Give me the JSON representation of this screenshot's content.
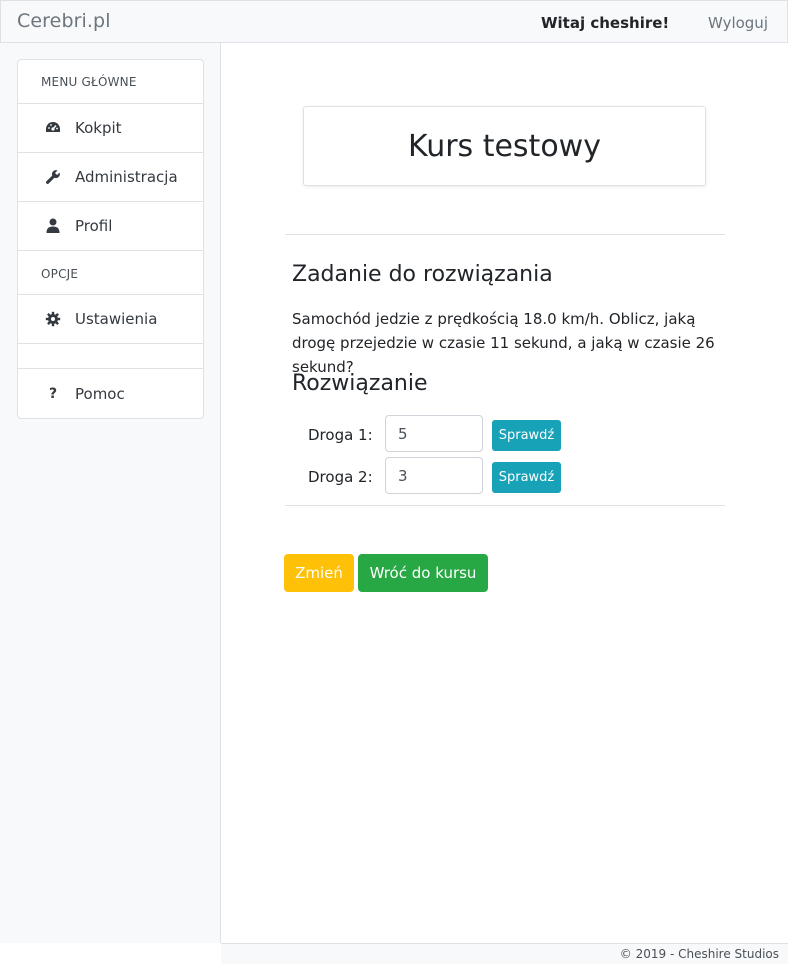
{
  "navbar": {
    "brand": "Cerebri.pl",
    "welcome": "Witaj cheshire!",
    "logout": "Wyloguj"
  },
  "sidebar": {
    "main_header": "MENU GŁÓWNE",
    "items": [
      {
        "label": "Kokpit",
        "icon": "dashboard-icon"
      },
      {
        "label": "Administracja",
        "icon": "wrench-icon"
      },
      {
        "label": "Profil",
        "icon": "user-icon"
      }
    ],
    "options_header": "OPCJE",
    "options": [
      {
        "label": "Ustawienia",
        "icon": "gear-icon"
      }
    ],
    "help": {
      "label": "Pomoc",
      "icon": "question-icon"
    }
  },
  "main": {
    "course_title": "Kurs testowy",
    "task_heading": "Zadanie do rozwiązania",
    "task_text": "Samochód jedzie z prędkością 18.0 km/h. Oblicz, jaką drogę przejedzie w czasie 11 sekund, a jaką w czasie 26 sekund?",
    "solution_heading": "Rozwiązanie",
    "answers": [
      {
        "label": "Droga 1:",
        "value": "5",
        "button": "Sprawdź"
      },
      {
        "label": "Droga 2:",
        "value": "3",
        "button": "Sprawdź"
      }
    ],
    "change_button": "Zmień",
    "back_button": "Wróć do kursu"
  },
  "footer": {
    "text": "© 2019 - Cheshire Studios"
  },
  "colors": {
    "info": "#17a2b8",
    "warning": "#ffc107",
    "success": "#28a745",
    "navbar_bg": "#f8f9fa"
  }
}
